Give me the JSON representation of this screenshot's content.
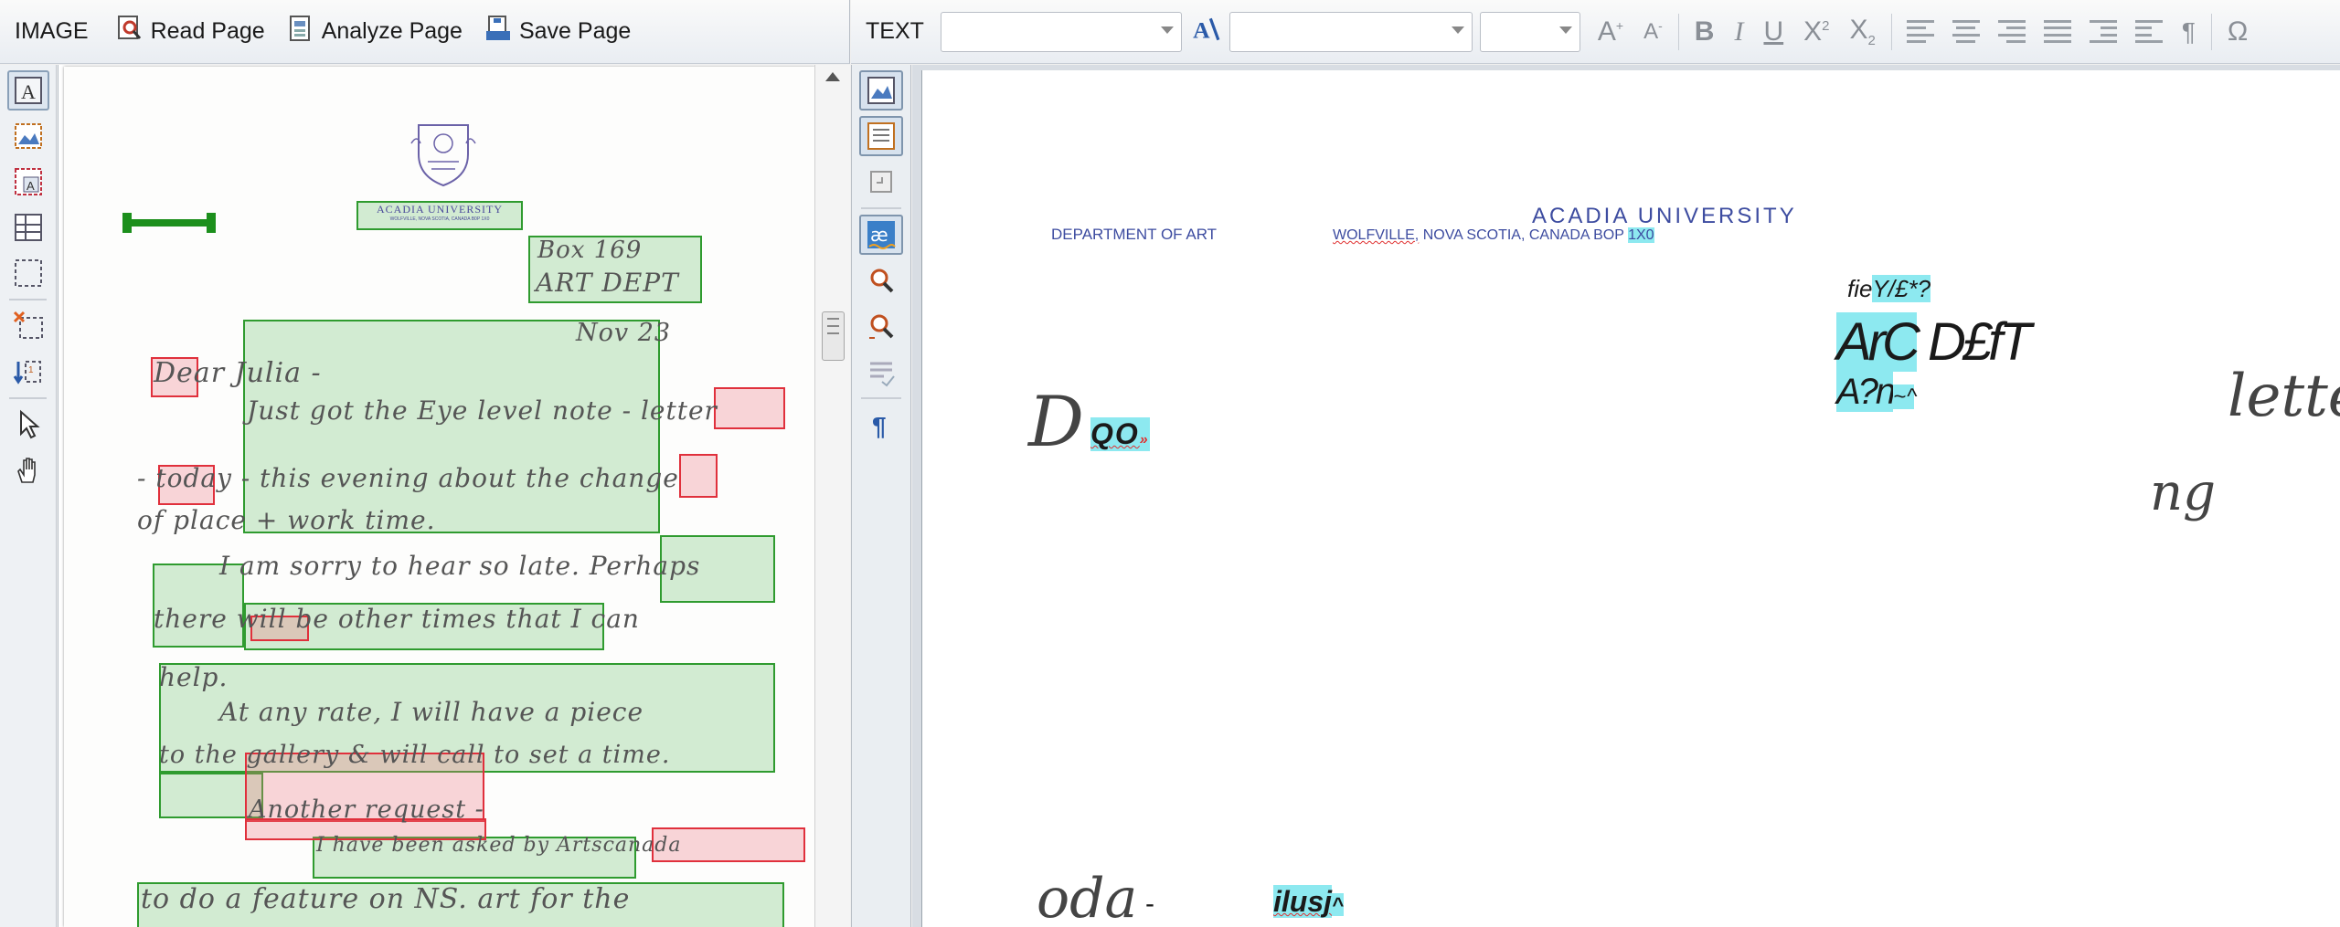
{
  "image_toolbar": {
    "section_label": "IMAGE",
    "read_page": "Read Page",
    "analyze_page": "Analyze Page",
    "save_page": "Save Page"
  },
  "text_toolbar": {
    "section_label": "TEXT",
    "style_combo_value": "",
    "font_combo_value": "",
    "size_combo_value": "",
    "buttons": [
      "A",
      "A",
      "B",
      "I",
      "U",
      "X2",
      "X2",
      "Ω"
    ]
  },
  "left_tools": [
    "text-area-tool",
    "picture-area-tool",
    "background-picture-area-tool",
    "table-area-tool",
    "barcode-area-tool",
    "delete-area-tool",
    "reorder-areas-tool",
    "select-tool",
    "hand-tool"
  ],
  "middle_tools": [
    "show-image-tool",
    "show-page-layout-tool",
    "sync-tool",
    "ligature-tool",
    "find-tool",
    "verify-tool",
    "formatting-tool",
    "pilcrow-tool"
  ],
  "scanned_document": {
    "letterhead_name": "ACADIA UNIVERSITY",
    "letterhead_address": "WOLFVILLE, NOVA SCOTIA, CANADA B0P 1X0",
    "handwriting": {
      "line_box": "Box 169",
      "line_dept": "ART DEPT",
      "line_date": "Nov 23",
      "line_greeting": "Dear Julia -",
      "line_1": "Just got the Eye level note - letter",
      "line_2": "- today - this evening about the change",
      "line_3": "of place + work time.",
      "line_4": "I am sorry to hear so late. Perhaps",
      "line_5": "there will be other times that I can",
      "line_6": "help.",
      "line_7": "At any rate, I will have a piece",
      "line_8": "to the gallery & will call to set a time.",
      "line_9": "Another request -",
      "line_10": "I have been asked by Artscanada",
      "line_11": "to do a feature on NS. art for the"
    }
  },
  "recognized_text": {
    "department": "DEPARTMENT OF ART",
    "university": "ACADIA UNIVERSITY",
    "address_word": "WOLFVILLE,",
    "address_rest": " NOVA SCOTIA, CANADA BOP ",
    "postal": "1X0",
    "box_prefix": "fie",
    "box_rest": "Y/£*?",
    "dept_a": "ArC",
    "dept_b": " D£fT",
    "date_a": "A?n",
    "date_b": "~ ^",
    "greeting_d": "D",
    "greeting_rest": "QO",
    "greeting_tail": "»",
    "letter_fragment": "lette",
    "ng_fragment": "ng",
    "today_fragment": "oda",
    "dash": "-",
    "ilusj": "ilusj",
    "caret": "^"
  },
  "colors": {
    "zone_green": "#2f9b2f",
    "zone_red": "#e0303c",
    "highlight": "#8de9f0",
    "letterhead_blue": "#4a5bb0"
  }
}
